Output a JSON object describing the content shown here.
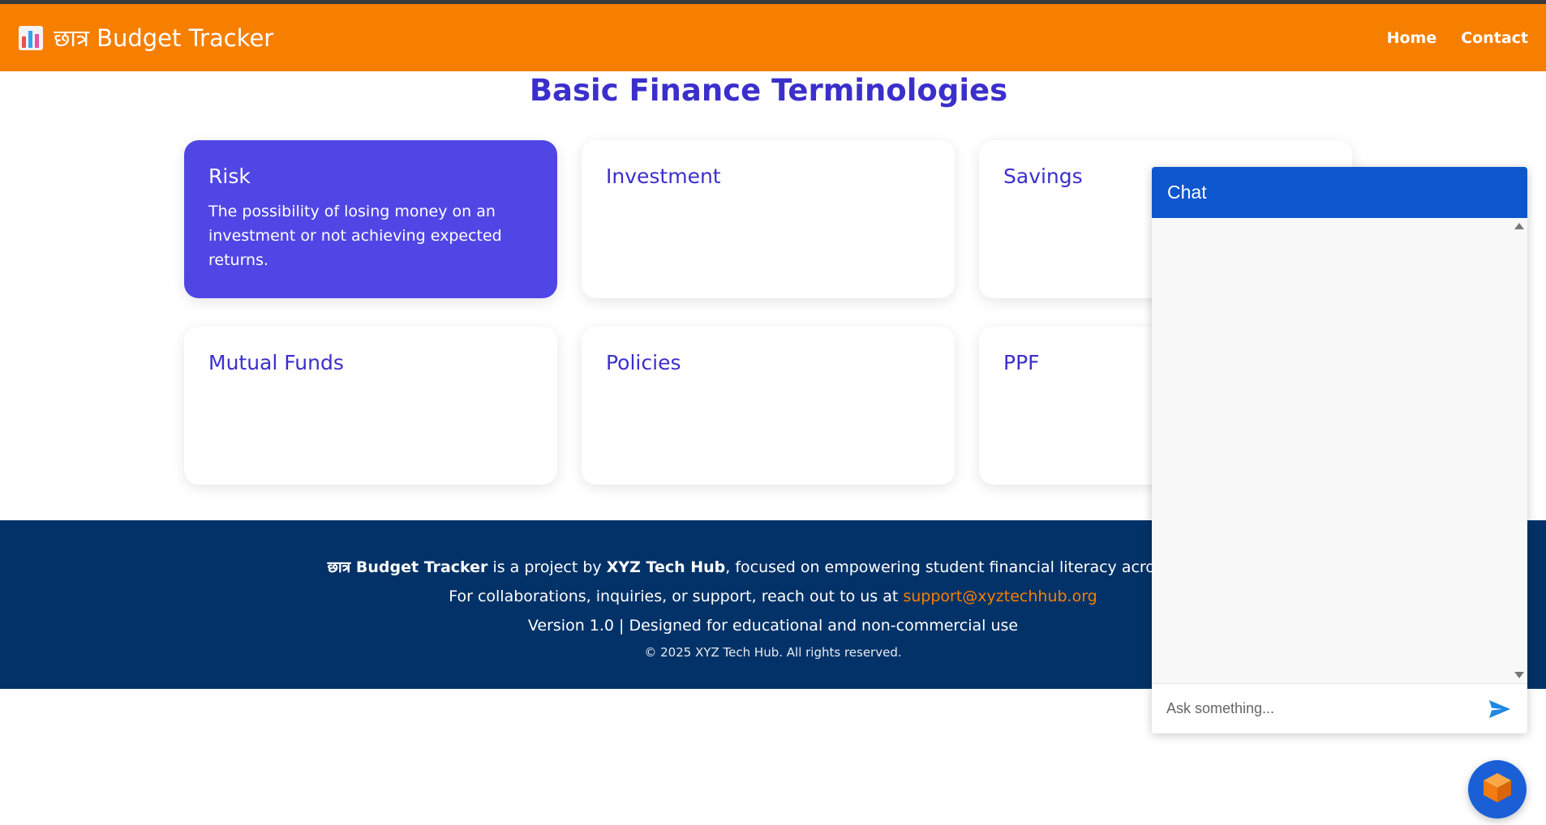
{
  "navbar": {
    "brand": "छात्र Budget Tracker",
    "links": [
      "Home",
      "Contact"
    ]
  },
  "page": {
    "title": "Basic Finance Terminologies"
  },
  "cards": [
    {
      "title": "Risk",
      "description": "The possibility of losing money on an investment or not achieving expected returns."
    },
    {
      "title": "Investment",
      "description": ""
    },
    {
      "title": "Savings",
      "description": ""
    },
    {
      "title": "Mutual Funds",
      "description": ""
    },
    {
      "title": "Policies",
      "description": ""
    },
    {
      "title": "PPF",
      "description": ""
    }
  ],
  "footer": {
    "line1_brand": "छात्र Budget Tracker",
    "line1_mid": " is a project by ",
    "line1_org": "XYZ Tech Hub",
    "line1_rest": ", focused on empowering student financial literacy across India.",
    "line2_text": "For collaborations, inquiries, or support, reach out to us at ",
    "email": "support@xyztechhub.org",
    "line3": "Version 1.0 | Designed for educational and non-commercial use",
    "copyright": "© 2025 XYZ Tech Hub. All rights reserved."
  },
  "chat": {
    "title": "Chat",
    "placeholder": "Ask something..."
  },
  "colors": {
    "navbar": "#f77f00",
    "accent": "#3b2fcc",
    "active_card": "#5046e5",
    "footer": "#033268",
    "chat_header": "#0c57ce"
  },
  "icons": {
    "brand": "bar-chart-icon",
    "send": "send-icon",
    "launcher": "cube-icon"
  }
}
